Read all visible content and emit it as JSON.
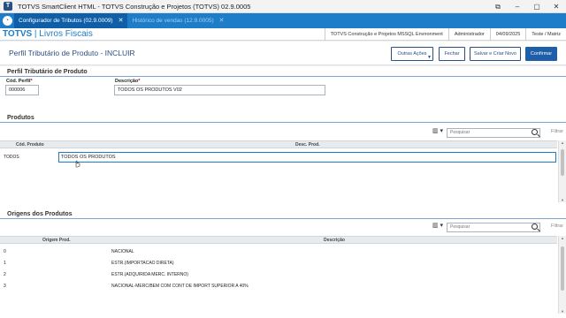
{
  "window": {
    "title": "TOTVS SmartClient HTML - TOTVS Construção e Projetos (TOTVS) 02.9.0005",
    "controls": [
      "⧉",
      "–",
      "▢",
      "✕"
    ]
  },
  "tabs": [
    {
      "label": "Configurador de Tributos (02.9.0009)",
      "close": "✕"
    },
    {
      "label": "Histórico de vendas (12.9.0005)",
      "close": "✕"
    }
  ],
  "brand": {
    "name": "TOTVS",
    "module": " | Livros Fiscais"
  },
  "environment": [
    "TOTVS Construção e Projetos MSSQL Environment",
    "Administrador",
    "04/09/2025",
    "Teste / Matriz"
  ],
  "page": {
    "title": "Perfil Tributário de Produto - INCLUIR",
    "buttons": {
      "outras_acoes": "Outras Ações",
      "fechar": "Fechar",
      "salvar_criar": "Salvar e Criar Novo",
      "confirmar": "Confirmar"
    }
  },
  "perfil": {
    "section_title": "Perfil Tributário de Produto",
    "cod_label": "Cód. Perfil",
    "cod_value": "000006",
    "desc_label": "Descrição",
    "desc_value": "TODOS OS PRODUTOS V02",
    "required_mark": "*"
  },
  "produtos": {
    "section_title": "Produtos",
    "search_placeholder": "Pesquisar",
    "filter_label": "Filtrar",
    "columns": [
      "Cód. Produto",
      "Desc. Prod."
    ],
    "rows": [
      {
        "cod": "TODOS",
        "desc": "TODOS OS PRODUTOS"
      }
    ]
  },
  "origens": {
    "section_title": "Origens dos Produtos",
    "search_placeholder": "Pesquisar",
    "filter_label": "Filtrar",
    "columns": [
      "Origem Prod.",
      "Descrição"
    ],
    "rows": [
      {
        "cod": "0",
        "desc": "NACIONAL"
      },
      {
        "cod": "1",
        "desc": "ESTR.(IMPORTACAO DIRETA)"
      },
      {
        "cod": "2",
        "desc": "ESTR.(ADQUIRIDA MERC. INTERNO)"
      },
      {
        "cod": "3",
        "desc": "NACIONAL-MERC/BEM COM CONT DE IMPORT SUPERIOR A 40%"
      }
    ]
  },
  "icons": {
    "columns": "columns-icon",
    "search": "search-icon"
  },
  "colors": {
    "accent": "#1d7dc9",
    "brand_dark": "#2a4f83",
    "primary_button": "#1d5fa8"
  }
}
